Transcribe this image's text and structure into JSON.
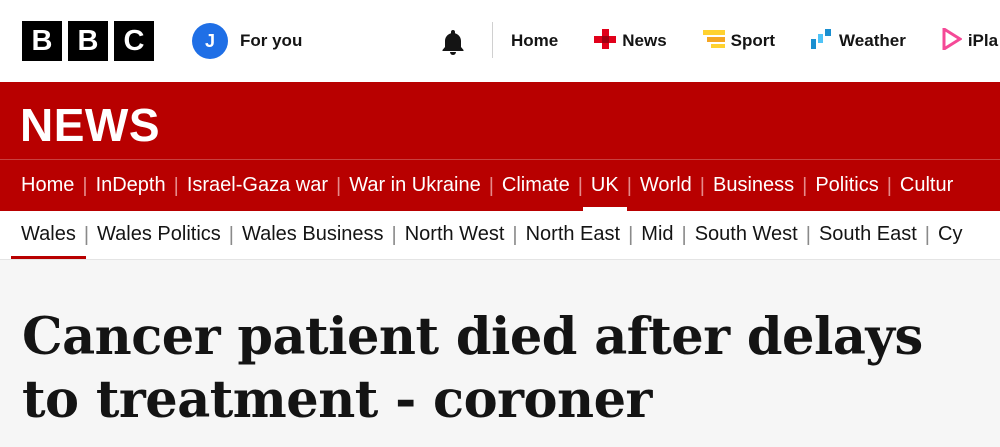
{
  "masthead": {
    "logo_letters": [
      "B",
      "B",
      "C"
    ],
    "avatar_initial": "J",
    "account_label": "For you",
    "nav": [
      {
        "label": "Home",
        "icon": "none"
      },
      {
        "label": "News",
        "icon": "news-icon",
        "color": "#e1001a"
      },
      {
        "label": "Sport",
        "icon": "sport-icon",
        "color": "#ffd230"
      },
      {
        "label": "Weather",
        "icon": "weather-icon",
        "color": "#1a8fd0"
      },
      {
        "label": "iPla",
        "icon": "iplayer-icon",
        "color": "#f54997"
      }
    ]
  },
  "banner": {
    "title": "NEWS"
  },
  "primary_nav": [
    "Home",
    "InDepth",
    "Israel-Gaza war",
    "War in Ukraine",
    "Climate",
    "UK",
    "World",
    "Business",
    "Politics",
    "Cultur"
  ],
  "primary_active": "UK",
  "secondary_nav": [
    "Wales",
    "Wales Politics",
    "Wales Business",
    "North West",
    "North East",
    "Mid",
    "South West",
    "South East",
    "Cy"
  ],
  "secondary_active": "Wales",
  "article": {
    "headline": "Cancer patient died after delays to treatment - coroner"
  },
  "colors": {
    "brand_red": "#b80000",
    "avatar_blue": "#1f6fe6"
  }
}
